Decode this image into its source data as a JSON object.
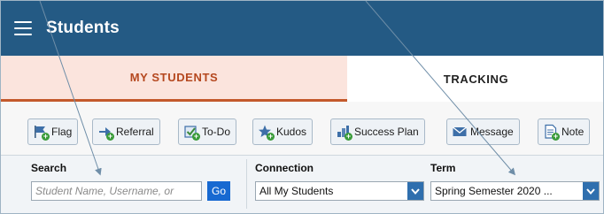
{
  "header": {
    "title": "Students"
  },
  "tabs": [
    {
      "label": "MY STUDENTS"
    },
    {
      "label": "TRACKING"
    }
  ],
  "toolbar": {
    "buttons": [
      {
        "label": "Flag",
        "icon": "flag-icon"
      },
      {
        "label": "Referral",
        "icon": "referral-icon"
      },
      {
        "label": "To-Do",
        "icon": "todo-icon"
      },
      {
        "label": "Kudos",
        "icon": "kudos-star-icon"
      },
      {
        "label": "Success Plan",
        "icon": "success-plan-icon"
      },
      {
        "label": "Message",
        "icon": "envelope-icon"
      },
      {
        "label": "Note",
        "icon": "note-icon"
      }
    ]
  },
  "filters": {
    "search": {
      "label": "Search",
      "placeholder": "Student Name, Username, or",
      "go_label": "Go"
    },
    "connection": {
      "label": "Connection",
      "value": "All My Students"
    },
    "term": {
      "label": "Term",
      "value": "Spring Semester 2020 ..."
    }
  },
  "colors": {
    "header_bg": "#245a84",
    "active_tab_bg": "#fbe4dd",
    "active_tab_text": "#b5481f",
    "go_button": "#1769d1",
    "select_arrow": "#2f6fae"
  }
}
